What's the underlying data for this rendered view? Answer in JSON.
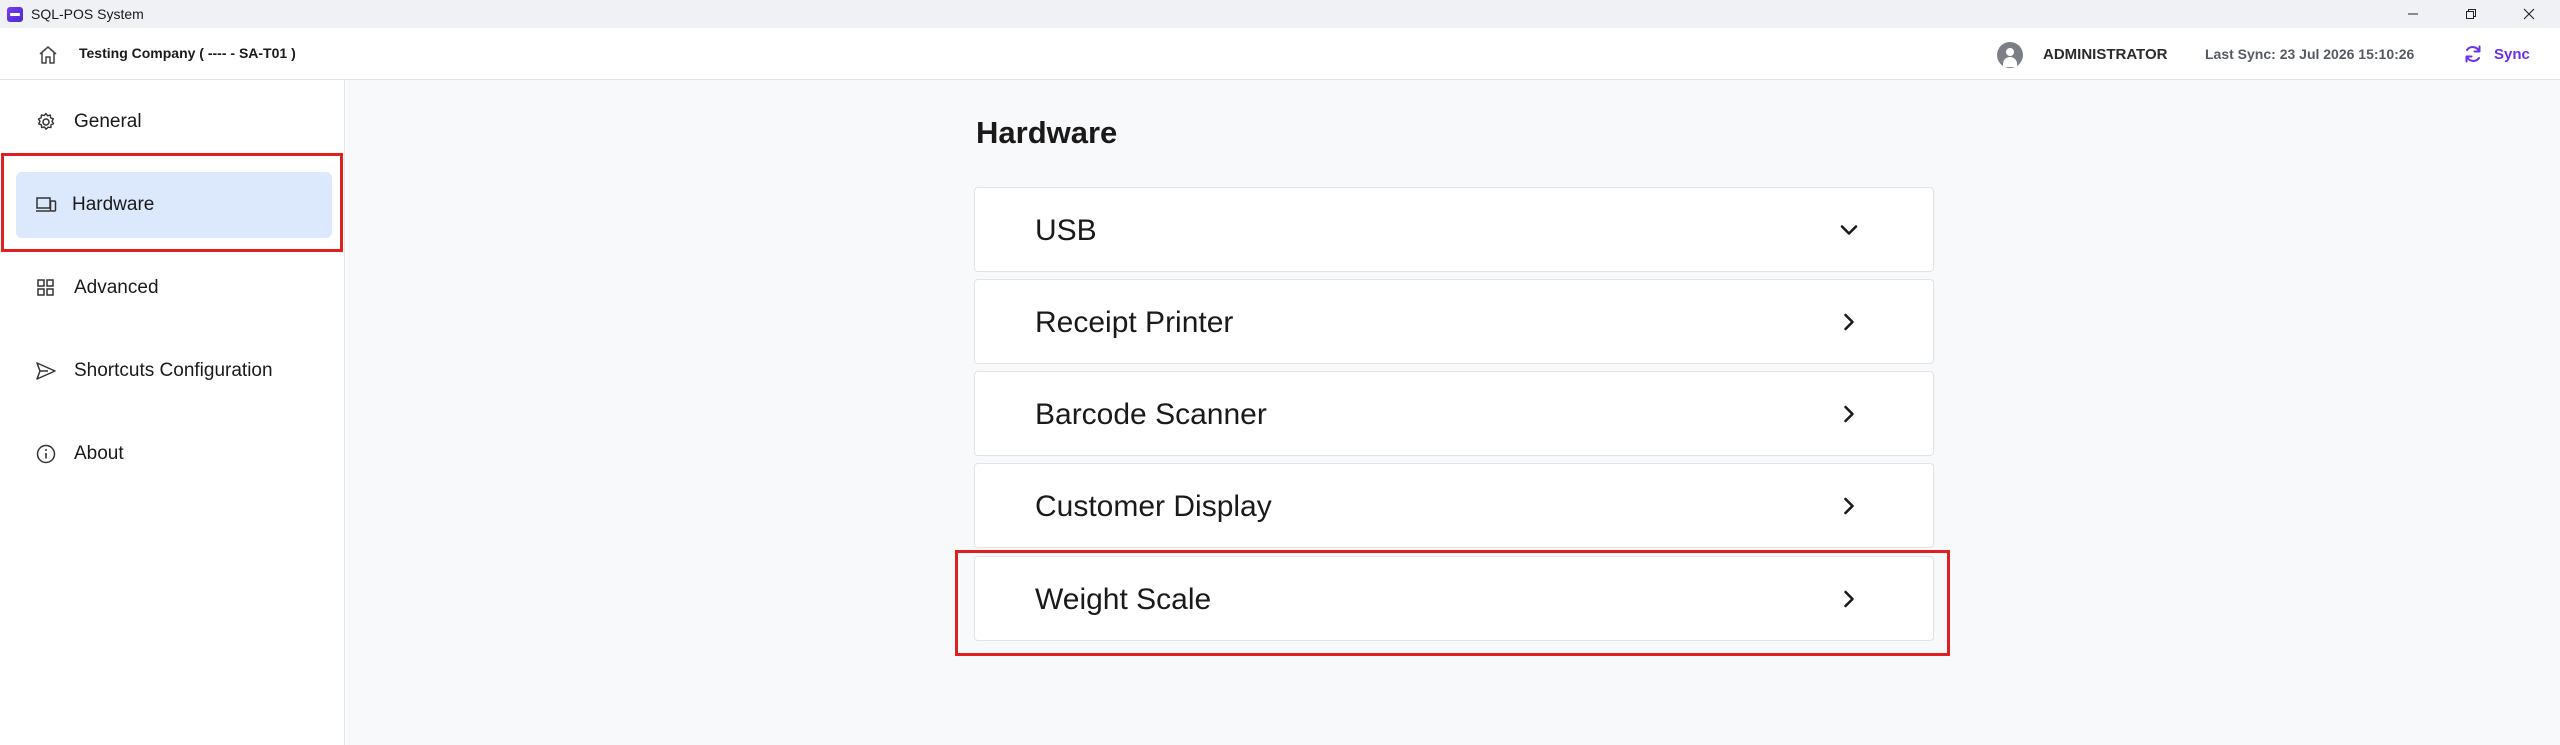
{
  "window": {
    "title": "SQL-POS System"
  },
  "header": {
    "company": "Testing Company ( ---- - SA-T01 )",
    "user": "ADMINISTRATOR",
    "last_sync": "Last Sync: 23 Jul 2026 15:10:26",
    "sync_label": "Sync"
  },
  "sidebar": {
    "items": [
      {
        "label": "General",
        "icon": "gear-icon",
        "active": false
      },
      {
        "label": "Hardware",
        "icon": "devices-icon",
        "active": true
      },
      {
        "label": "Advanced",
        "icon": "grid-icon",
        "active": false
      },
      {
        "label": "Shortcuts Configuration",
        "icon": "send-icon",
        "active": false
      },
      {
        "label": "About",
        "icon": "info-icon",
        "active": false
      }
    ]
  },
  "main": {
    "title": "Hardware",
    "sections": [
      {
        "label": "USB",
        "icon": "chevron-down-icon",
        "expanded": true
      },
      {
        "label": "Receipt Printer",
        "icon": "chevron-right-icon",
        "expanded": false
      },
      {
        "label": "Barcode Scanner",
        "icon": "chevron-right-icon",
        "expanded": false
      },
      {
        "label": "Customer Display",
        "icon": "chevron-right-icon",
        "expanded": false
      },
      {
        "label": "Weight Scale",
        "icon": "chevron-right-icon",
        "expanded": false
      }
    ]
  },
  "colors": {
    "accent": "#6b2ff0",
    "active_bg": "#dce8fb",
    "highlight": "#e02020",
    "main_bg": "#f8f9fb"
  }
}
